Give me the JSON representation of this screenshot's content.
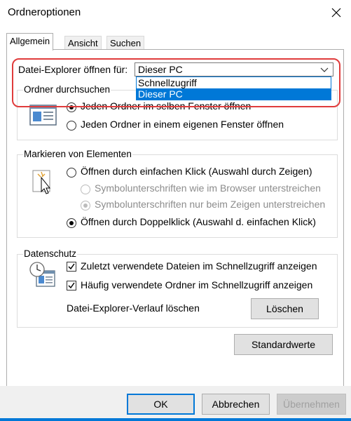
{
  "window": {
    "title": "Ordneroptionen"
  },
  "tabs": [
    {
      "label": "Allgemein",
      "active": true
    },
    {
      "label": "Ansicht",
      "active": false
    },
    {
      "label": "Suchen",
      "active": false
    }
  ],
  "open_for": {
    "label": "Datei-Explorer öffnen für:",
    "value": "Dieser PC",
    "options": [
      "Schnellzugriff",
      "Dieser PC"
    ],
    "selected": "Dieser PC"
  },
  "browse_group": {
    "legend": "Ordner durchsuchen",
    "options": [
      {
        "label": "Jeden Ordner im selben Fenster öffnen",
        "checked": true
      },
      {
        "label": "Jeden Ordner in einem eigenen Fenster öffnen",
        "checked": false
      }
    ]
  },
  "click_group": {
    "legend": "Markieren von Elementen",
    "options": [
      {
        "label": "Öffnen durch einfachen Klick (Auswahl durch Zeigen)",
        "checked": false
      },
      {
        "label": "Symbolunterschriften wie im Browser unterstreichen",
        "checked": false,
        "disabled": true
      },
      {
        "label": "Symbolunterschriften nur beim Zeigen unterstreichen",
        "checked": true,
        "disabled": true
      },
      {
        "label": "Öffnen durch Doppelklick (Auswahl d. einfachen Klick)",
        "checked": true
      }
    ]
  },
  "privacy_group": {
    "legend": "Datenschutz",
    "checks": [
      {
        "label": "Zuletzt verwendete Dateien im Schnellzugriff anzeigen",
        "checked": true
      },
      {
        "label": "Häufig verwendete Ordner im Schnellzugriff anzeigen",
        "checked": true
      }
    ],
    "clear_label": "Datei-Explorer-Verlauf löschen",
    "clear_button": "Löschen"
  },
  "restore_button": "Standardwerte",
  "footer": {
    "ok": "OK",
    "cancel": "Abbrechen",
    "apply": "Übernehmen"
  },
  "colors": {
    "accent": "#0078d7",
    "highlight": "#e03c3c"
  }
}
